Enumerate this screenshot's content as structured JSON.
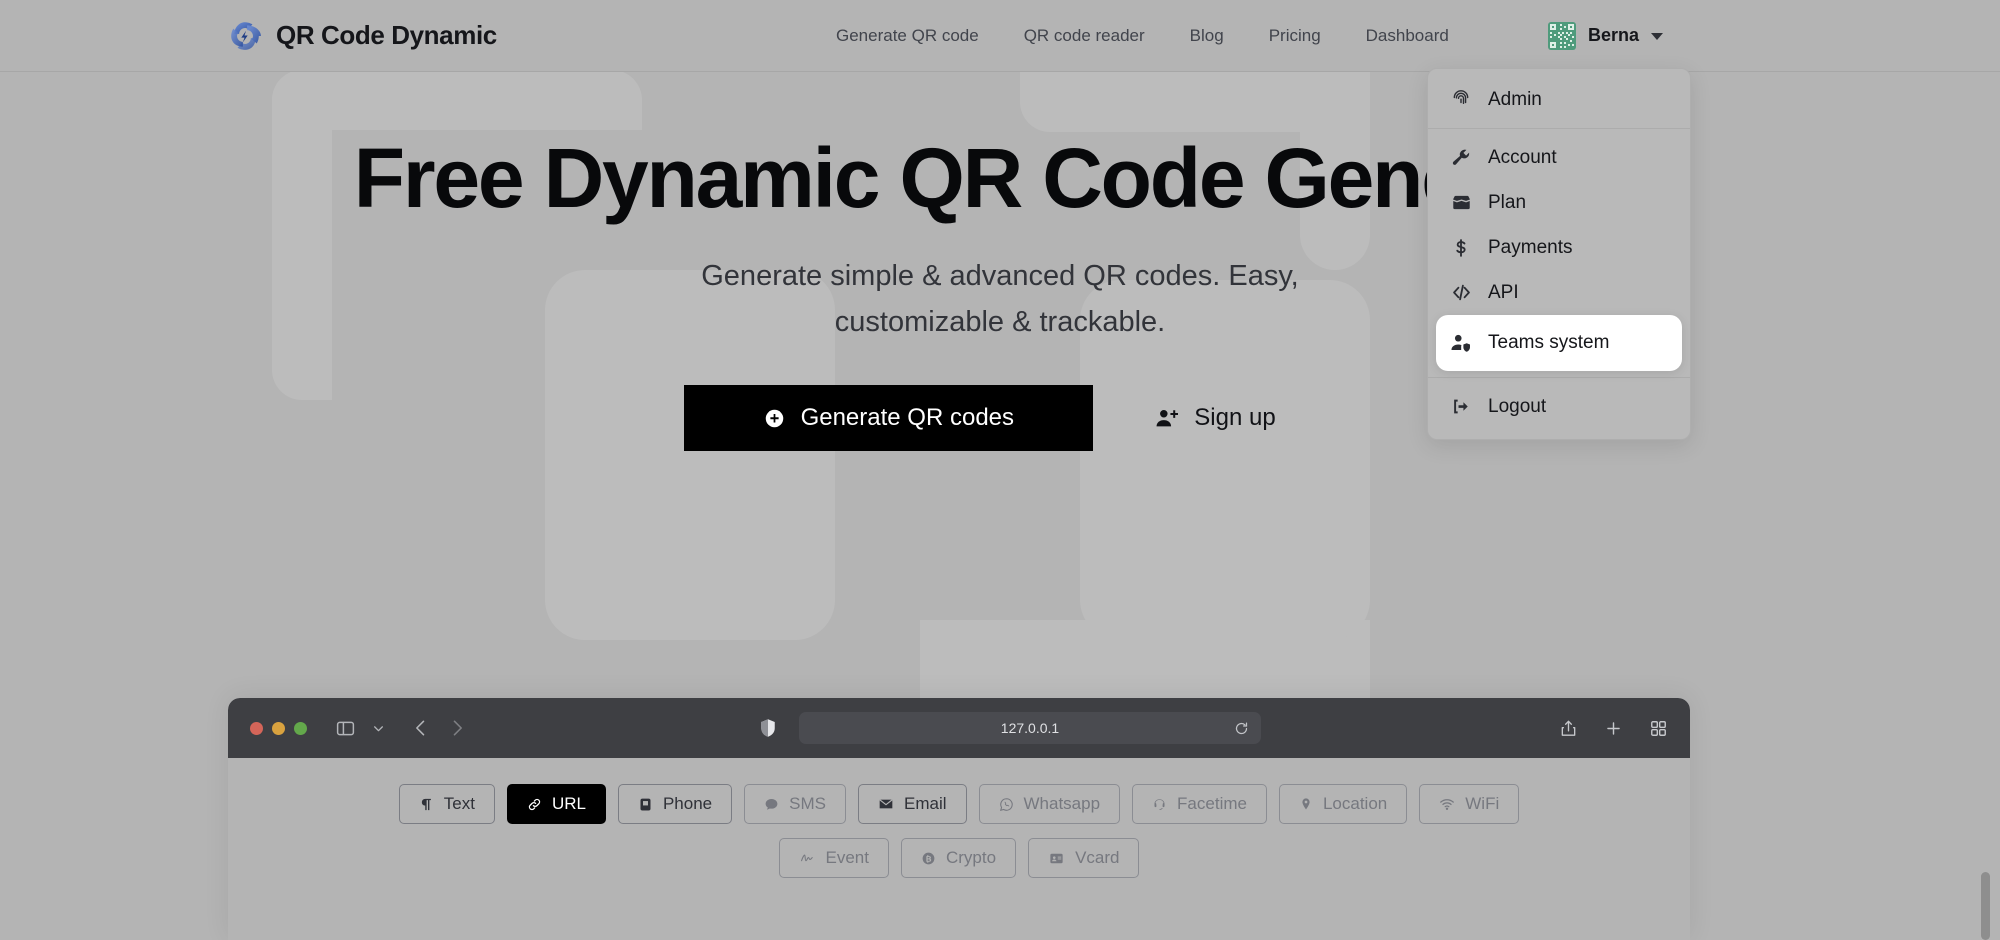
{
  "header": {
    "brand": {
      "name": "QR Code Dynamic",
      "logo_icon": "qr-dynamic-swirl-logo"
    },
    "nav": [
      {
        "label": "Generate QR code"
      },
      {
        "label": "QR code reader"
      },
      {
        "label": "Blog"
      },
      {
        "label": "Pricing"
      },
      {
        "label": "Dashboard"
      }
    ],
    "user": {
      "name": "Berna",
      "avatar_icon": "qr-avatar",
      "caret_icon": "chevron-down-icon"
    }
  },
  "user_dropdown": {
    "items": [
      {
        "label": "Admin",
        "icon": "fingerprint-icon",
        "active": false
      },
      {
        "label": "Account",
        "icon": "wrench-icon",
        "active": false
      },
      {
        "label": "Plan",
        "icon": "open-box-icon",
        "active": false
      },
      {
        "label": "Payments",
        "icon": "dollar-icon",
        "active": false
      },
      {
        "label": "API",
        "icon": "code-brackets-icon",
        "active": false
      },
      {
        "label": "Teams system",
        "icon": "user-shield-icon",
        "active": true
      },
      {
        "label": "Logout",
        "icon": "logout-arrow-icon",
        "active": false
      }
    ]
  },
  "hero": {
    "title": "Free Dynamic QR Code Generator",
    "subtitle": "Generate simple & advanced QR codes. Easy, customizable & trackable.",
    "primary_button": {
      "label": "Generate QR codes",
      "icon": "plus-circle-icon"
    },
    "secondary_button": {
      "label": "Sign up",
      "icon": "user-plus-icon"
    }
  },
  "browser_mockup": {
    "url": "127.0.0.1",
    "toolbar_icons": {
      "sidebar": "sidebar-toggle-icon",
      "chevron": "chevron-down-icon",
      "back": "chevron-left-icon",
      "forward": "chevron-right-icon",
      "shield": "shield-icon",
      "reload": "reload-icon",
      "share": "share-icon",
      "new_tab": "plus-icon",
      "tab_overview": "grid-icon"
    },
    "chips_row_1": [
      {
        "label": "Text",
        "icon": "pilcrow-icon",
        "state": "normal"
      },
      {
        "label": "URL",
        "icon": "link-icon",
        "state": "active"
      },
      {
        "label": "Phone",
        "icon": "phone-icon",
        "state": "normal"
      },
      {
        "label": "SMS",
        "icon": "chat-bubble-icon",
        "state": "muted"
      },
      {
        "label": "Email",
        "icon": "envelope-icon",
        "state": "normal"
      },
      {
        "label": "Whatsapp",
        "icon": "whatsapp-icon",
        "state": "muted"
      },
      {
        "label": "Facetime",
        "icon": "facetime-icon",
        "state": "muted"
      },
      {
        "label": "Location",
        "icon": "map-pin-icon",
        "state": "muted"
      },
      {
        "label": "WiFi",
        "icon": "wifi-icon",
        "state": "muted"
      }
    ],
    "chips_row_2": [
      {
        "label": "Event",
        "icon": "signature-icon",
        "state": "muted"
      },
      {
        "label": "Crypto",
        "icon": "bitcoin-icon",
        "state": "muted"
      },
      {
        "label": "Vcard",
        "icon": "id-card-icon",
        "state": "muted"
      }
    ]
  },
  "colors": {
    "page_background": "#b4b4b4",
    "primary_button": "#000000",
    "browser_toolbar": "#3e3f43",
    "active_menu_item": "#ffffff",
    "logo_blue": "#3a5fb0",
    "avatar_green": "#4f9b7c"
  }
}
